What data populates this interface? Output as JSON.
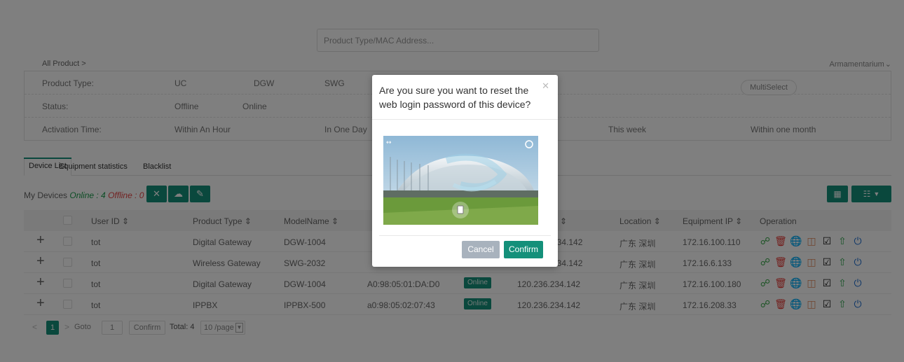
{
  "search": {
    "placeholder": "Product Type/MAC Address..."
  },
  "breadcrumb": "All Product >",
  "armamentarium": "Armamentarium",
  "filters": {
    "product_type": {
      "label": "Product Type:",
      "options": [
        "UC",
        "DGW",
        "SWG"
      ],
      "multiselect": "MultiSelect"
    },
    "status": {
      "label": "Status:",
      "options": [
        "Offline",
        "Online"
      ]
    },
    "activation_time": {
      "label": "Activation Time:",
      "options": [
        "Within An Hour",
        "In One Day",
        "This week",
        "Within one month"
      ]
    }
  },
  "tabs": [
    "Device List",
    "Equipment statistics",
    "Blacklist"
  ],
  "device_status": {
    "prefix": "My Devices",
    "online_label": "Online : 4",
    "offline_label": "Offline : 0"
  },
  "table": {
    "headers": [
      "User ID",
      "Product Type",
      "ModelName",
      "↕",
      "Location",
      "Equipment IP",
      "Operation"
    ],
    "rows": [
      {
        "user": "tot",
        "type": "Digital Gateway",
        "model": "DGW-1004",
        "mac": "",
        "status": "",
        "ip": "234.142",
        "location": "广东 深圳",
        "eqip": "172.16.100.110"
      },
      {
        "user": "tot",
        "type": "Wireless Gateway",
        "model": "SWG-2032",
        "mac": "",
        "status": "",
        "ip": "234.142",
        "location": "广东 深圳",
        "eqip": "172.16.6.133"
      },
      {
        "user": "tot",
        "type": "Digital Gateway",
        "model": "DGW-1004",
        "mac": "A0:98:05:01:DA:D0",
        "status": "Online",
        "ip": "120.236.234.142",
        "location": "广东 深圳",
        "eqip": "172.16.100.180"
      },
      {
        "user": "tot",
        "type": "IPPBX",
        "model": "IPPBX-500",
        "mac": "a0:98:05:02:07:43",
        "status": "Online",
        "ip": "120.236.234.142",
        "location": "广东 深圳",
        "eqip": "172.16.208.33"
      }
    ]
  },
  "pager": {
    "current": "1",
    "goto_label": "Goto",
    "goto_value": "1",
    "confirm": "Confirm",
    "total": "Total: 4",
    "page_size": "10 /page"
  },
  "modal": {
    "title": "Are you sure you want to reset the web login password of this device?",
    "cancel": "Cancel",
    "confirm": "Confirm"
  },
  "colors": {
    "accent": "#14907a",
    "online": "#1a9a4a",
    "offline": "#e54545",
    "plus": "#2f73c8"
  }
}
